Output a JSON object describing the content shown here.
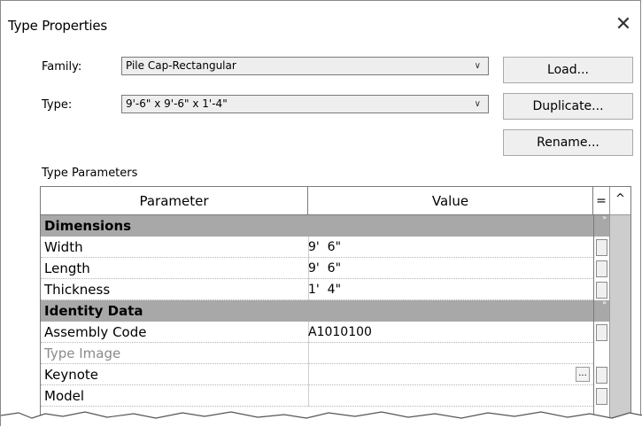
{
  "dialog": {
    "title": "Type Properties",
    "close_glyph": "✕"
  },
  "fields": {
    "family_label": "Family:",
    "family_value": "Pile Cap-Rectangular",
    "type_label": "Type:",
    "type_value": "9'-6\" x 9'-6\" x 1'-4\""
  },
  "buttons": {
    "load": "Load...",
    "duplicate": "Duplicate...",
    "rename": "Rename..."
  },
  "section_label": "Type Parameters",
  "table": {
    "headers": {
      "parameter": "Parameter",
      "value": "Value",
      "eq": "="
    },
    "groups": [
      {
        "name": "Dimensions"
      },
      {
        "name": "Identity Data"
      }
    ],
    "rows": [
      {
        "parameter": "Width",
        "value": "9'  6\""
      },
      {
        "parameter": "Length",
        "value": "9'  6\""
      },
      {
        "parameter": "Thickness",
        "value": "1'  4\""
      },
      {
        "parameter": "Assembly Code",
        "value": "A1010100"
      },
      {
        "parameter": "Type Image",
        "value": ""
      },
      {
        "parameter": "Keynote",
        "value": "",
        "button": "..."
      },
      {
        "parameter": "Model",
        "value": ""
      }
    ]
  },
  "scroll": {
    "up_glyph": "^",
    "collapse_glyph": "»"
  }
}
